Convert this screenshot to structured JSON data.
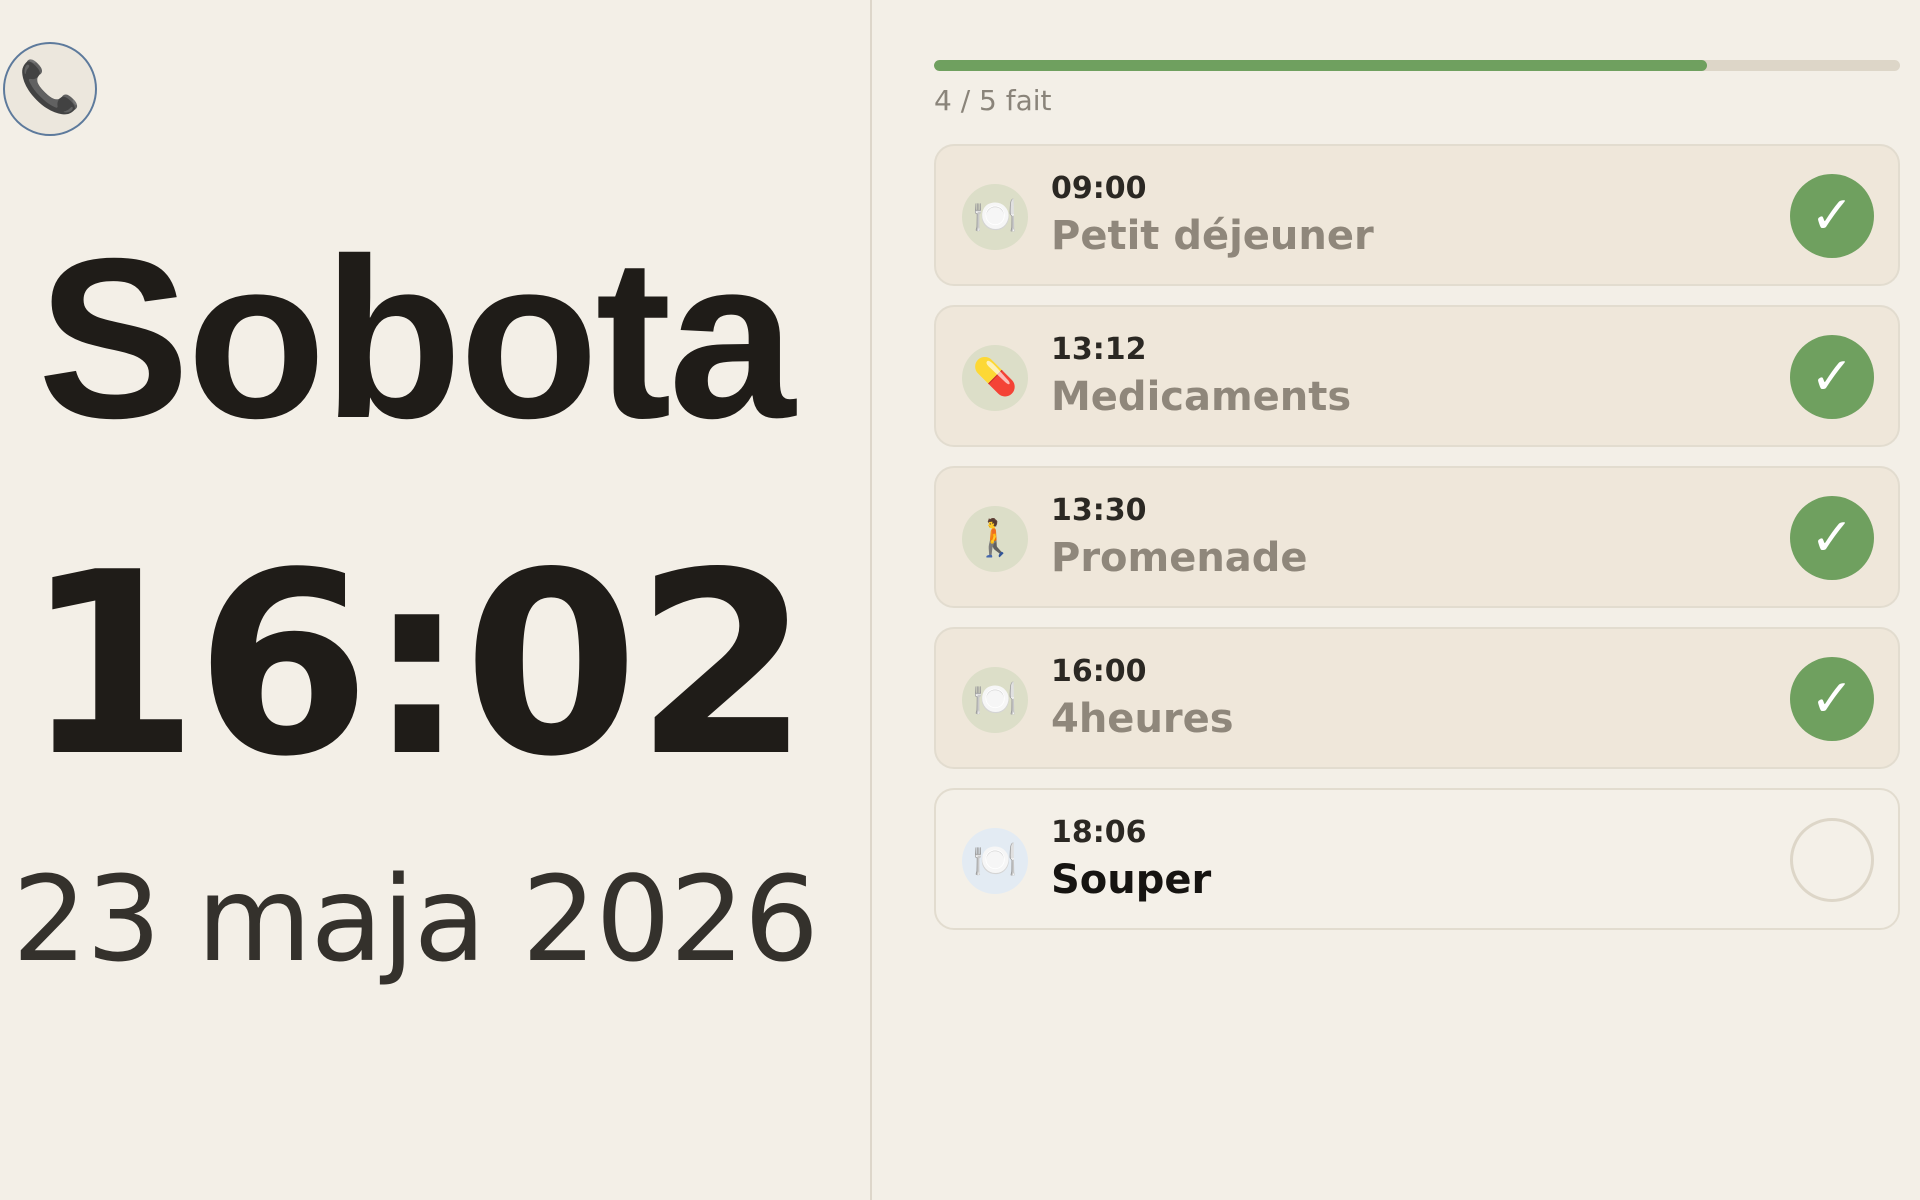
{
  "call_button": {
    "icon": "phone-icon",
    "glyph": "📞"
  },
  "clock": {
    "day": "Sobota",
    "time": "16:02",
    "date": "23 maja 2026"
  },
  "progress": {
    "completed": 4,
    "total": 5,
    "fraction": 0.8,
    "label": "4 / 5 fait",
    "fill_color": "#6fa05f",
    "track_color": "#ddd6c8"
  },
  "tasks": [
    {
      "time": "09:00",
      "name": "Petit déjeuner",
      "icon": "meal-icon",
      "glyph": "🍽️",
      "done": true,
      "check_glyph": "✓"
    },
    {
      "time": "13:12",
      "name": "Medicaments",
      "icon": "pill-icon",
      "glyph": "💊",
      "done": true,
      "check_glyph": "✓"
    },
    {
      "time": "13:30",
      "name": "Promenade",
      "icon": "walking-icon",
      "glyph": "🚶",
      "done": true,
      "check_glyph": "✓"
    },
    {
      "time": "16:00",
      "name": "4heures",
      "icon": "meal-icon",
      "glyph": "🍽️",
      "done": true,
      "check_glyph": "✓"
    },
    {
      "time": "18:06",
      "name": "Souper",
      "icon": "meal-icon",
      "glyph": "🍽️",
      "done": false,
      "check_glyph": ""
    }
  ],
  "colors": {
    "background": "#f3efe7",
    "done_green": "#6fa05f",
    "card_done": "#efe7da",
    "card_pending": "#f4f0e8",
    "call_border": "#5d7a9c"
  }
}
